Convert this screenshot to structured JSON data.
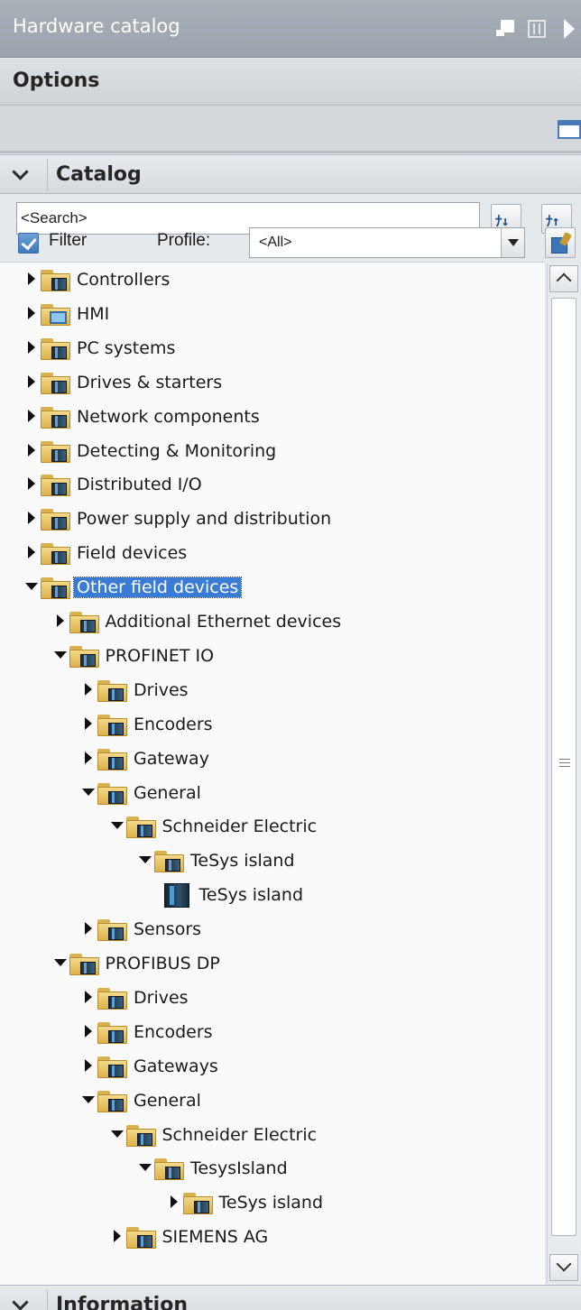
{
  "panel": {
    "title": "Hardware catalog"
  },
  "options": {
    "label": "Options"
  },
  "catalog": {
    "label": "Catalog",
    "search": {
      "value": "<Search>"
    },
    "filter": {
      "label": "Filter",
      "checked": true
    },
    "profile": {
      "label": "Profile:",
      "value": "<All>"
    }
  },
  "tree": [
    {
      "label": "Controllers",
      "depth": 0,
      "state": "collapsed",
      "icon": "folder-device"
    },
    {
      "label": "HMI",
      "depth": 0,
      "state": "collapsed",
      "icon": "folder-hmi"
    },
    {
      "label": "PC systems",
      "depth": 0,
      "state": "collapsed",
      "icon": "folder-device"
    },
    {
      "label": "Drives & starters",
      "depth": 0,
      "state": "collapsed",
      "icon": "folder-device"
    },
    {
      "label": "Network components",
      "depth": 0,
      "state": "collapsed",
      "icon": "folder-device"
    },
    {
      "label": "Detecting & Monitoring",
      "depth": 0,
      "state": "collapsed",
      "icon": "folder-device"
    },
    {
      "label": "Distributed I/O",
      "depth": 0,
      "state": "collapsed",
      "icon": "folder-device"
    },
    {
      "label": "Power supply and distribution",
      "depth": 0,
      "state": "collapsed",
      "icon": "folder-device"
    },
    {
      "label": "Field devices",
      "depth": 0,
      "state": "collapsed",
      "icon": "folder-device"
    },
    {
      "label": "Other field devices",
      "depth": 0,
      "state": "expanded",
      "icon": "folder-device",
      "selected": true
    },
    {
      "label": "Additional Ethernet devices",
      "depth": 1,
      "state": "collapsed",
      "icon": "folder-device"
    },
    {
      "label": "PROFINET IO",
      "depth": 1,
      "state": "expanded",
      "icon": "folder-device"
    },
    {
      "label": "Drives",
      "depth": 2,
      "state": "collapsed",
      "icon": "folder-device"
    },
    {
      "label": "Encoders",
      "depth": 2,
      "state": "collapsed",
      "icon": "folder-device"
    },
    {
      "label": "Gateway",
      "depth": 2,
      "state": "collapsed",
      "icon": "folder-device"
    },
    {
      "label": "General",
      "depth": 2,
      "state": "expanded",
      "icon": "folder-device"
    },
    {
      "label": "Schneider Electric",
      "depth": 3,
      "state": "expanded",
      "icon": "folder-device"
    },
    {
      "label": "TeSys island",
      "depth": 4,
      "state": "expanded",
      "icon": "folder-device"
    },
    {
      "label": "TeSys island",
      "depth": 5,
      "state": "leaf",
      "icon": "device"
    },
    {
      "label": "Sensors",
      "depth": 2,
      "state": "collapsed",
      "icon": "folder-device"
    },
    {
      "label": "PROFIBUS DP",
      "depth": 1,
      "state": "expanded",
      "icon": "folder-device"
    },
    {
      "label": "Drives",
      "depth": 2,
      "state": "collapsed",
      "icon": "folder-device"
    },
    {
      "label": "Encoders",
      "depth": 2,
      "state": "collapsed",
      "icon": "folder-device"
    },
    {
      "label": "Gateways",
      "depth": 2,
      "state": "collapsed",
      "icon": "folder-device"
    },
    {
      "label": "General",
      "depth": 2,
      "state": "expanded",
      "icon": "folder-device"
    },
    {
      "label": "Schneider Electric",
      "depth": 3,
      "state": "expanded",
      "icon": "folder-device"
    },
    {
      "label": "TesysIsland",
      "depth": 4,
      "state": "expanded",
      "icon": "folder-device"
    },
    {
      "label": "TeSys island",
      "depth": 5,
      "state": "collapsed",
      "icon": "folder-device"
    },
    {
      "label": "SIEMENS AG",
      "depth": 3,
      "state": "collapsed",
      "icon": "folder-device"
    }
  ],
  "information": {
    "label": "Information"
  },
  "colors": {
    "accent": "#3a7bd5",
    "titlebar": "#a1a9b1",
    "folder": "#e8c567"
  }
}
